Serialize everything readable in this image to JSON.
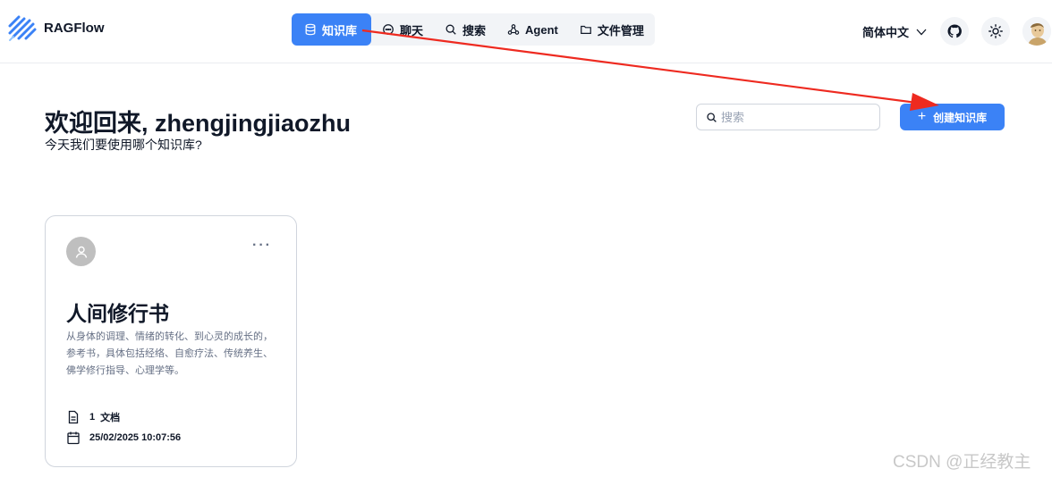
{
  "brand": {
    "name": "RAGFlow",
    "accent_color": "#3b82f6",
    "annotation_color": "#ee2a20"
  },
  "nav": {
    "items": [
      {
        "label": "知识库",
        "icon": "database-icon",
        "active": true
      },
      {
        "label": "聊天",
        "icon": "chat-icon",
        "active": false
      },
      {
        "label": "搜索",
        "icon": "search-icon",
        "active": false
      },
      {
        "label": "Agent",
        "icon": "agent-graph-icon",
        "active": false
      },
      {
        "label": "文件管理",
        "icon": "folder-icon",
        "active": false
      }
    ]
  },
  "header": {
    "language": "简体中文",
    "icons": [
      "chevron-down-icon",
      "github-icon",
      "sun-icon",
      "user-avatar"
    ]
  },
  "main": {
    "welcome": "欢迎回来, zhengjingjiaozhu",
    "subtitle": "今天我们要使用哪个知识库?",
    "search_placeholder": "搜索",
    "create_button": "创建知识库"
  },
  "knowledge_bases": [
    {
      "title": "人间修行书",
      "description": "从身体的调理、情绪的转化、到心灵的成长的，参考书，具体包括经络、自愈疗法、传统养生、佛学修行指导、心理学等。",
      "doc_count": "1",
      "doc_label": "文档",
      "updated": "25/02/2025 10:07:56",
      "more": "···"
    }
  ],
  "watermark": "CSDN @正经教主"
}
